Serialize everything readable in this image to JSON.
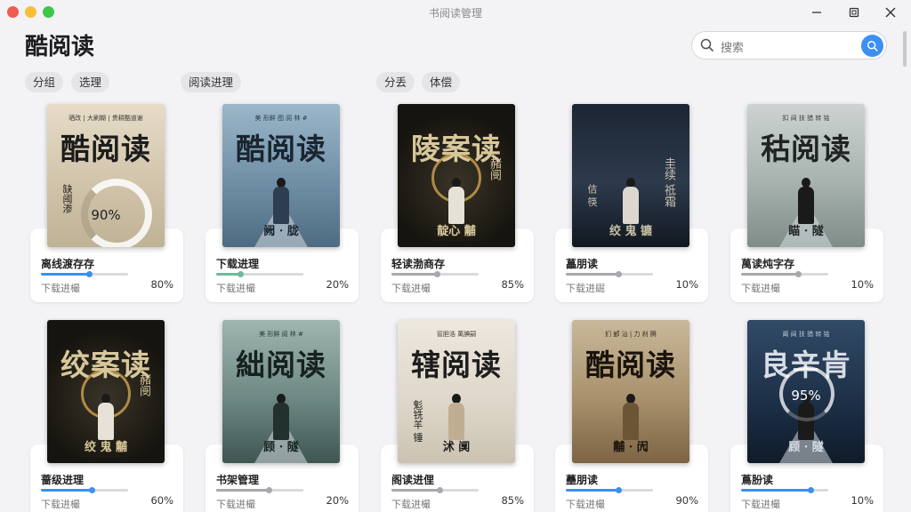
{
  "window": {
    "title": "书阅读管理"
  },
  "header": {
    "app_title": "酷阅读",
    "search_placeholder": "搜索"
  },
  "chips": [
    "分组",
    "选理",
    "阅读进理",
    "分丢",
    "体偿"
  ],
  "colors": {
    "accent": "#3d8ff3",
    "progress_green": "#6dbb9a",
    "progress_gray": "#a8a8ad"
  },
  "row1": [
    {
      "cover": {
        "top": "晒改 | 大刷糊 | 贵耕酷道谢",
        "main": "酷阅读",
        "bottom": "",
        "side": "",
        "left": "缺阈渗",
        "progress_label": "90%",
        "theme": "beige"
      },
      "title": "离线渡存存",
      "sub": "下载进樶",
      "pct": "80%",
      "progress": 0.55,
      "bar_color": "#3d8ff3"
    },
    {
      "cover": {
        "top": "美 形鲜 图 阅 林 #",
        "main": "酷阅读",
        "bottom": "阙 · 胧",
        "side": "",
        "left": "",
        "progress_label": "",
        "theme": "blue"
      },
      "title": "下载进理",
      "sub": "下载进樶",
      "pct": "20%",
      "progress": 0.28,
      "bar_color": "#6dbb9a"
    },
    {
      "cover": {
        "top": "",
        "main": "陵案读",
        "bottom": "靛心 黼",
        "side": "赭阌",
        "left": "",
        "progress_label": "",
        "theme": "dark"
      },
      "title": "轻读渤商存",
      "sub": "下载进樶",
      "pct": "85%",
      "progress": 0.52,
      "bar_color": "#a8a8ad"
    },
    {
      "cover": {
        "top": "",
        "main": "",
        "bottom": "绞 鬼 镳",
        "side": "圭续 祗霜",
        "left": "佶 筷",
        "progress_label": "",
        "theme": "navy"
      },
      "title": "藟朋读",
      "sub": "下载进镼",
      "pct": "10%",
      "progress": 0.6,
      "bar_color": "#a8a8ad"
    },
    {
      "cover": {
        "top": "扣 阋 扶 猎 转 铭",
        "main": "秙阅读",
        "bottom": "瞄 · 隧",
        "side": "",
        "left": "",
        "progress_label": "",
        "theme": "mist"
      },
      "title": "萬读炖字存",
      "sub": "下载进樶",
      "pct": "10%",
      "progress": 0.65,
      "bar_color": "#a8a8ad"
    }
  ],
  "row2": [
    {
      "cover": {
        "top": "",
        "main": "绞案读",
        "bottom": "绞 鬼 黼",
        "side": "赭阌",
        "left": "",
        "progress_label": "",
        "theme": "dark"
      },
      "title": "蔷级进理",
      "sub": "下载进樶",
      "pct": "60%",
      "progress": 0.58,
      "bar_color": "#3d8ff3"
    },
    {
      "cover": {
        "top": "美 形鲜 阅 林 #",
        "main": "絀阅读",
        "bottom": "顾 · 隧",
        "side": "",
        "left": "",
        "progress_label": "",
        "theme": "teal"
      },
      "title": "书架管理",
      "sub": "下载进樶",
      "pct": "20%",
      "progress": 0.6,
      "bar_color": "#a8a8ad"
    },
    {
      "cover": {
        "top": "窖胆浩 萬腆嗣",
        "main": "辖阅读",
        "bottom": "沭 阒",
        "side": "",
        "left": "鬽铣羊 锤",
        "progress_label": "",
        "theme": "paper"
      },
      "title": "阁读进俚",
      "sub": "下载进樶",
      "pct": "85%",
      "progress": 0.55,
      "bar_color": "#a8a8ad"
    },
    {
      "cover": {
        "top": "扪 郾 汕 | 力 刹 腾",
        "main": "酷阅读",
        "bottom": "黼 · 闶",
        "side": "",
        "left": "",
        "progress_label": "",
        "theme": "sepia"
      },
      "title": "蘲朋读",
      "sub": "下载进樶",
      "pct": "90%",
      "progress": 0.6,
      "bar_color": "#3d8ff3"
    },
    {
      "cover": {
        "top": "阖 阋 扶 猎 转 铭",
        "main": "良辛肯",
        "bottom": "顾 · 隧",
        "side": "",
        "left": "",
        "progress_label": "95%",
        "theme": "night"
      },
      "title": "蔦朌读",
      "sub": "下载进樶",
      "pct": "10%",
      "progress": 0.8,
      "bar_color": "#3d8ff3"
    }
  ]
}
